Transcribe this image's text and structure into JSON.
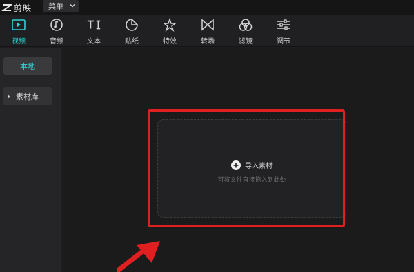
{
  "app": {
    "name": "剪映",
    "menu_label": "菜单"
  },
  "toolbar": {
    "items": [
      {
        "label": "视频",
        "icon": "video-icon",
        "active": true
      },
      {
        "label": "音频",
        "icon": "audio-icon",
        "active": false
      },
      {
        "label": "文本",
        "icon": "text-icon",
        "active": false
      },
      {
        "label": "贴纸",
        "icon": "sticker-icon",
        "active": false
      },
      {
        "label": "特效",
        "icon": "effects-icon",
        "active": false
      },
      {
        "label": "转场",
        "icon": "transition-icon",
        "active": false
      },
      {
        "label": "滤镜",
        "icon": "filter-icon",
        "active": false
      },
      {
        "label": "调节",
        "icon": "adjust-icon",
        "active": false
      }
    ]
  },
  "sidebar": {
    "local_label": "本地",
    "library_label": "素材库"
  },
  "dropzone": {
    "import_label": "导入素材",
    "hint": "可将文件直接拖入到此处"
  },
  "colors": {
    "accent": "#2ed3d3",
    "highlight": "#e02020"
  }
}
